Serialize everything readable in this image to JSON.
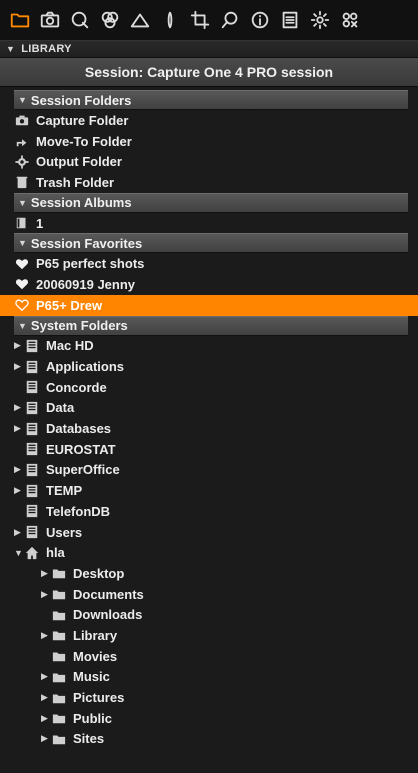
{
  "toolbar": {
    "tools": [
      {
        "icon": "folder-icon",
        "active": true
      },
      {
        "icon": "camera-icon"
      },
      {
        "icon": "quality-icon"
      },
      {
        "icon": "color-circles-icon"
      },
      {
        "icon": "exposure-icon"
      },
      {
        "icon": "lens-icon"
      },
      {
        "icon": "crop-icon"
      },
      {
        "icon": "loupe-icon"
      },
      {
        "icon": "info-icon"
      },
      {
        "icon": "list-icon"
      },
      {
        "icon": "gear-icon"
      },
      {
        "icon": "batch-icon"
      }
    ]
  },
  "library": {
    "header": "LIBRARY",
    "session_title": "Session:  Capture One 4 PRO session"
  },
  "sections": {
    "session_folders": {
      "title": "Session Folders",
      "items": [
        {
          "label": "Capture Folder",
          "icon": "camera-small-icon"
        },
        {
          "label": "Move-To Folder",
          "icon": "move-arrow-icon"
        },
        {
          "label": "Output Folder",
          "icon": "gear-small-icon"
        },
        {
          "label": "Trash Folder",
          "icon": "trash-icon"
        }
      ]
    },
    "session_albums": {
      "title": "Session Albums",
      "items": [
        {
          "label": "1",
          "icon": "album-icon"
        }
      ]
    },
    "session_favorites": {
      "title": "Session Favorites",
      "items": [
        {
          "label": "P65 perfect shots",
          "icon": "heart-icon"
        },
        {
          "label": "20060919 Jenny",
          "icon": "heart-icon"
        },
        {
          "label": "P65+ Drew",
          "icon": "heart-icon",
          "selected": true
        }
      ]
    },
    "system_folders": {
      "title": "System Folders",
      "items": [
        {
          "label": "Mac HD",
          "icon": "drive-icon",
          "expandable": true
        },
        {
          "label": "Applications",
          "icon": "drive-icon",
          "expandable": true
        },
        {
          "label": "Concorde",
          "icon": "drive-icon",
          "expandable": false
        },
        {
          "label": "Data",
          "icon": "drive-icon",
          "expandable": true
        },
        {
          "label": "Databases",
          "icon": "drive-icon",
          "expandable": true
        },
        {
          "label": "EUROSTAT",
          "icon": "drive-icon",
          "expandable": false
        },
        {
          "label": "SuperOffice",
          "icon": "drive-icon",
          "expandable": true
        },
        {
          "label": "TEMP",
          "icon": "drive-icon",
          "expandable": true
        },
        {
          "label": "TelefonDB",
          "icon": "drive-icon",
          "expandable": false
        },
        {
          "label": "Users",
          "icon": "drive-icon",
          "expandable": true
        },
        {
          "label": "hla",
          "icon": "home-icon",
          "expandable": true,
          "expanded": true
        },
        {
          "label": "Desktop",
          "icon": "folder-small-icon",
          "expandable": true,
          "child": true
        },
        {
          "label": "Documents",
          "icon": "folder-small-icon",
          "expandable": true,
          "child": true
        },
        {
          "label": "Downloads",
          "icon": "folder-small-icon",
          "expandable": false,
          "child": true
        },
        {
          "label": "Library",
          "icon": "folder-small-icon",
          "expandable": true,
          "child": true
        },
        {
          "label": "Movies",
          "icon": "folder-small-icon",
          "expandable": false,
          "child": true
        },
        {
          "label": "Music",
          "icon": "folder-small-icon",
          "expandable": true,
          "child": true
        },
        {
          "label": "Pictures",
          "icon": "folder-small-icon",
          "expandable": true,
          "child": true
        },
        {
          "label": "Public",
          "icon": "folder-small-icon",
          "expandable": true,
          "child": true
        },
        {
          "label": "Sites",
          "icon": "folder-small-icon",
          "expandable": true,
          "child": true
        }
      ]
    }
  },
  "colors": {
    "accent": "#ff8a00",
    "selection": "#ff8400",
    "background": "#1b1b1b"
  }
}
